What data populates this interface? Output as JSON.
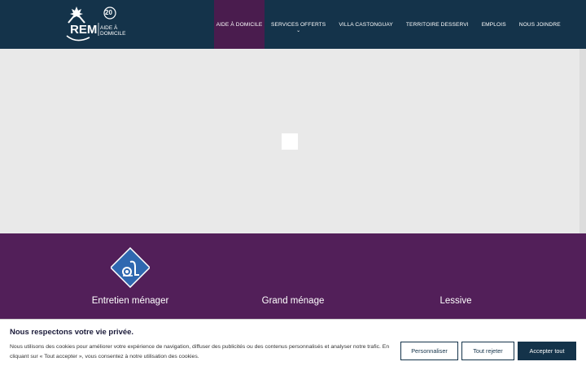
{
  "header": {
    "logo": {
      "brand": "REM",
      "line1": "AIDE À",
      "line2": "DOMICILE",
      "badge": "20"
    },
    "nav": [
      {
        "label": "AIDE À DOMICILE",
        "active": true
      },
      {
        "label": "SERVICES OFFERTS",
        "has_dropdown": true,
        "chevron": "⌄"
      },
      {
        "label": "VILLA CASTONGUAY"
      },
      {
        "label": "TERRITOIRE DESSERVI"
      },
      {
        "label": "EMPLOIS"
      },
      {
        "label": "NOUS JOINDRE"
      }
    ]
  },
  "services": [
    {
      "label": "Entretien ménager",
      "icon": "vacuum-icon"
    },
    {
      "label": "Grand ménage"
    },
    {
      "label": "Lessive"
    }
  ],
  "cookie": {
    "title": "Nous respectons votre vie privée.",
    "text": "Nous utilisons des cookies pour améliorer votre expérience de navigation, diffuser des publicités ou des contenus personnalisés et analyser notre trafic. En cliquant sur « Tout accepter », vous consentez à notre utilisation des cookies.",
    "buttons": {
      "customize": "Personnaliser",
      "reject": "Tout rejeter",
      "accept": "Accepter tout"
    }
  },
  "colors": {
    "header_bg": "#14334a",
    "nav_active_bg": "#4a1c4e",
    "services_bg": "#521f59",
    "icon_blue": "#2f68b0"
  }
}
